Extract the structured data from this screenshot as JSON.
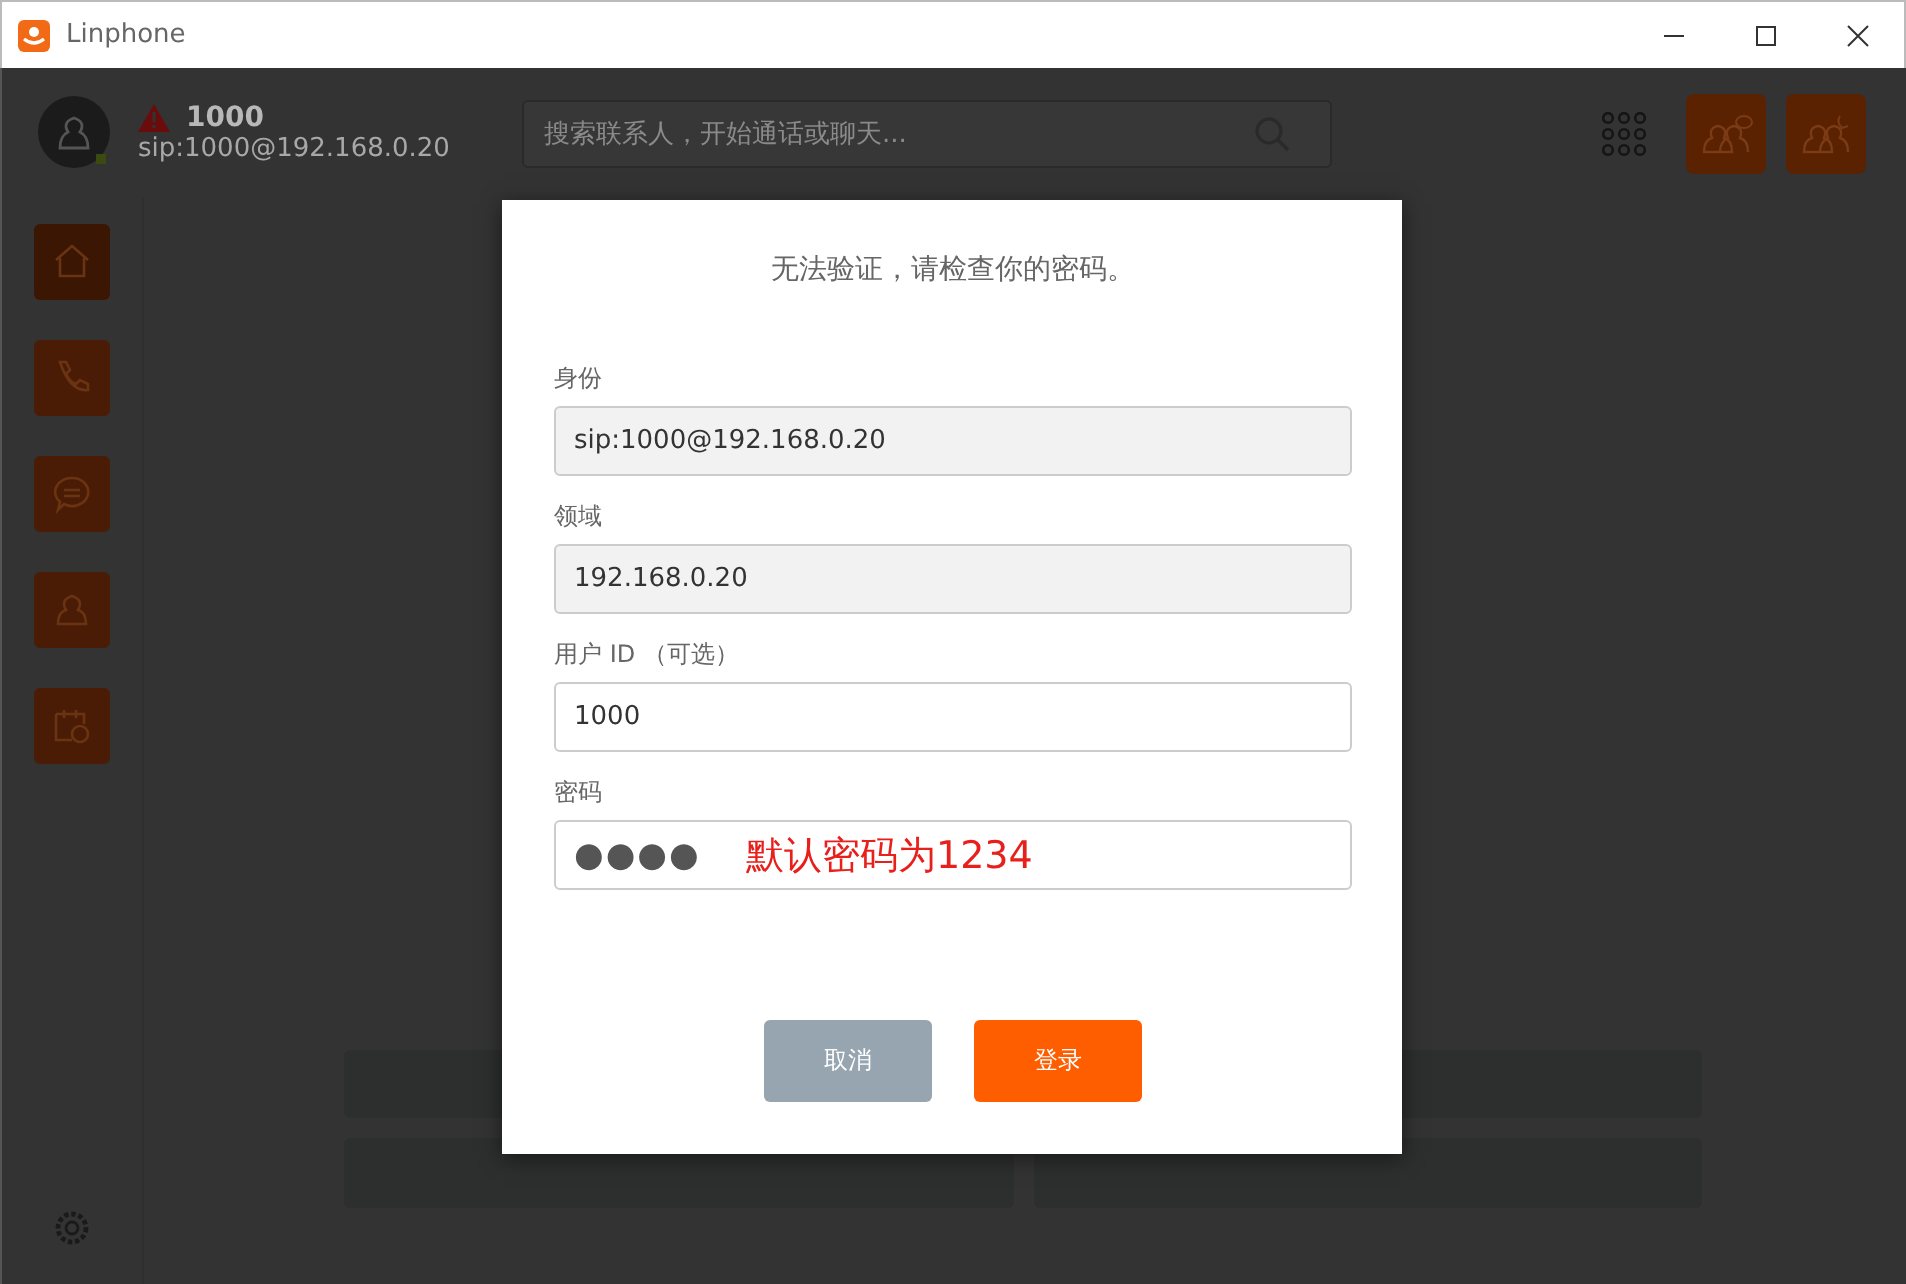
{
  "window": {
    "title": "Linphone"
  },
  "account": {
    "name": "1000",
    "address": "sip:1000@192.168.0.20",
    "warning": true
  },
  "search": {
    "placeholder": "搜索联系人，开始通话或聊天..."
  },
  "dialog": {
    "message": "无法验证，请检查你的密码。",
    "fields": [
      {
        "label": "身份",
        "value": "sip:1000@192.168.0.20",
        "kind": "readonly"
      },
      {
        "label": "领域",
        "value": "192.168.0.20",
        "kind": "readonly"
      },
      {
        "label": "用户 ID （可选）",
        "value": "1000",
        "kind": "editable"
      },
      {
        "label": "密码",
        "value": "●●●●",
        "kind": "password",
        "annotation": "默认密码为1234"
      }
    ],
    "buttons": [
      {
        "label": "取消",
        "kind": "secondary"
      },
      {
        "label": "登录",
        "kind": "primary"
      }
    ]
  }
}
